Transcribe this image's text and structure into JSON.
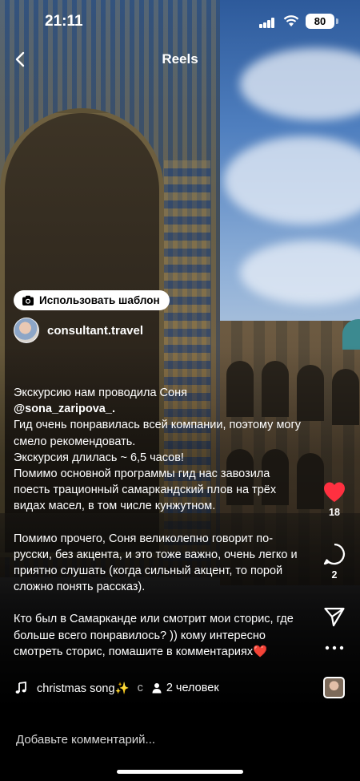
{
  "status_bar": {
    "time": "21:11",
    "battery": "80"
  },
  "header": {
    "title": "Reels"
  },
  "template_button": {
    "label": "Использовать шаблон"
  },
  "user": {
    "username": "consultant.travel"
  },
  "caption": {
    "lines": [
      "Экскурсию нам проводила Соня",
      "@sona_zaripova_.",
      "Гид очень понравилась всей компании, поэтому могу смело рекомендовать.",
      "Экскурсия длилась ~ 6,5 часов!",
      "Помимо основной программы гид нас завозила поесть трационный самаркандский плов на трёх видах масел, в том числе кунжутном.",
      "Помимо прочего, Соня великолепно говорит по-русски, без акцента, и это тоже важно, очень легко и приятно слушать (когда сильный акцент, то порой сложно понять рассказ).",
      "Кто был в Самарканде или смотрит мои сторис, где больше всего понравилось? )) кому интересно смотреть сторис, помашите в комментариях❤️"
    ]
  },
  "actions": {
    "likes": "18",
    "comments": "2"
  },
  "music": {
    "track": "christmas song✨",
    "separator": "c",
    "people": "2 человек"
  },
  "comment_bar": {
    "placeholder": "Добавьте комментарий..."
  },
  "colors": {
    "like": "#ff3040",
    "background": "#000000"
  },
  "icons": [
    "back-arrow-icon",
    "camera-icon",
    "heart-icon",
    "comment-icon",
    "share-icon",
    "more-icon",
    "music-note-icon",
    "person-icon"
  ]
}
